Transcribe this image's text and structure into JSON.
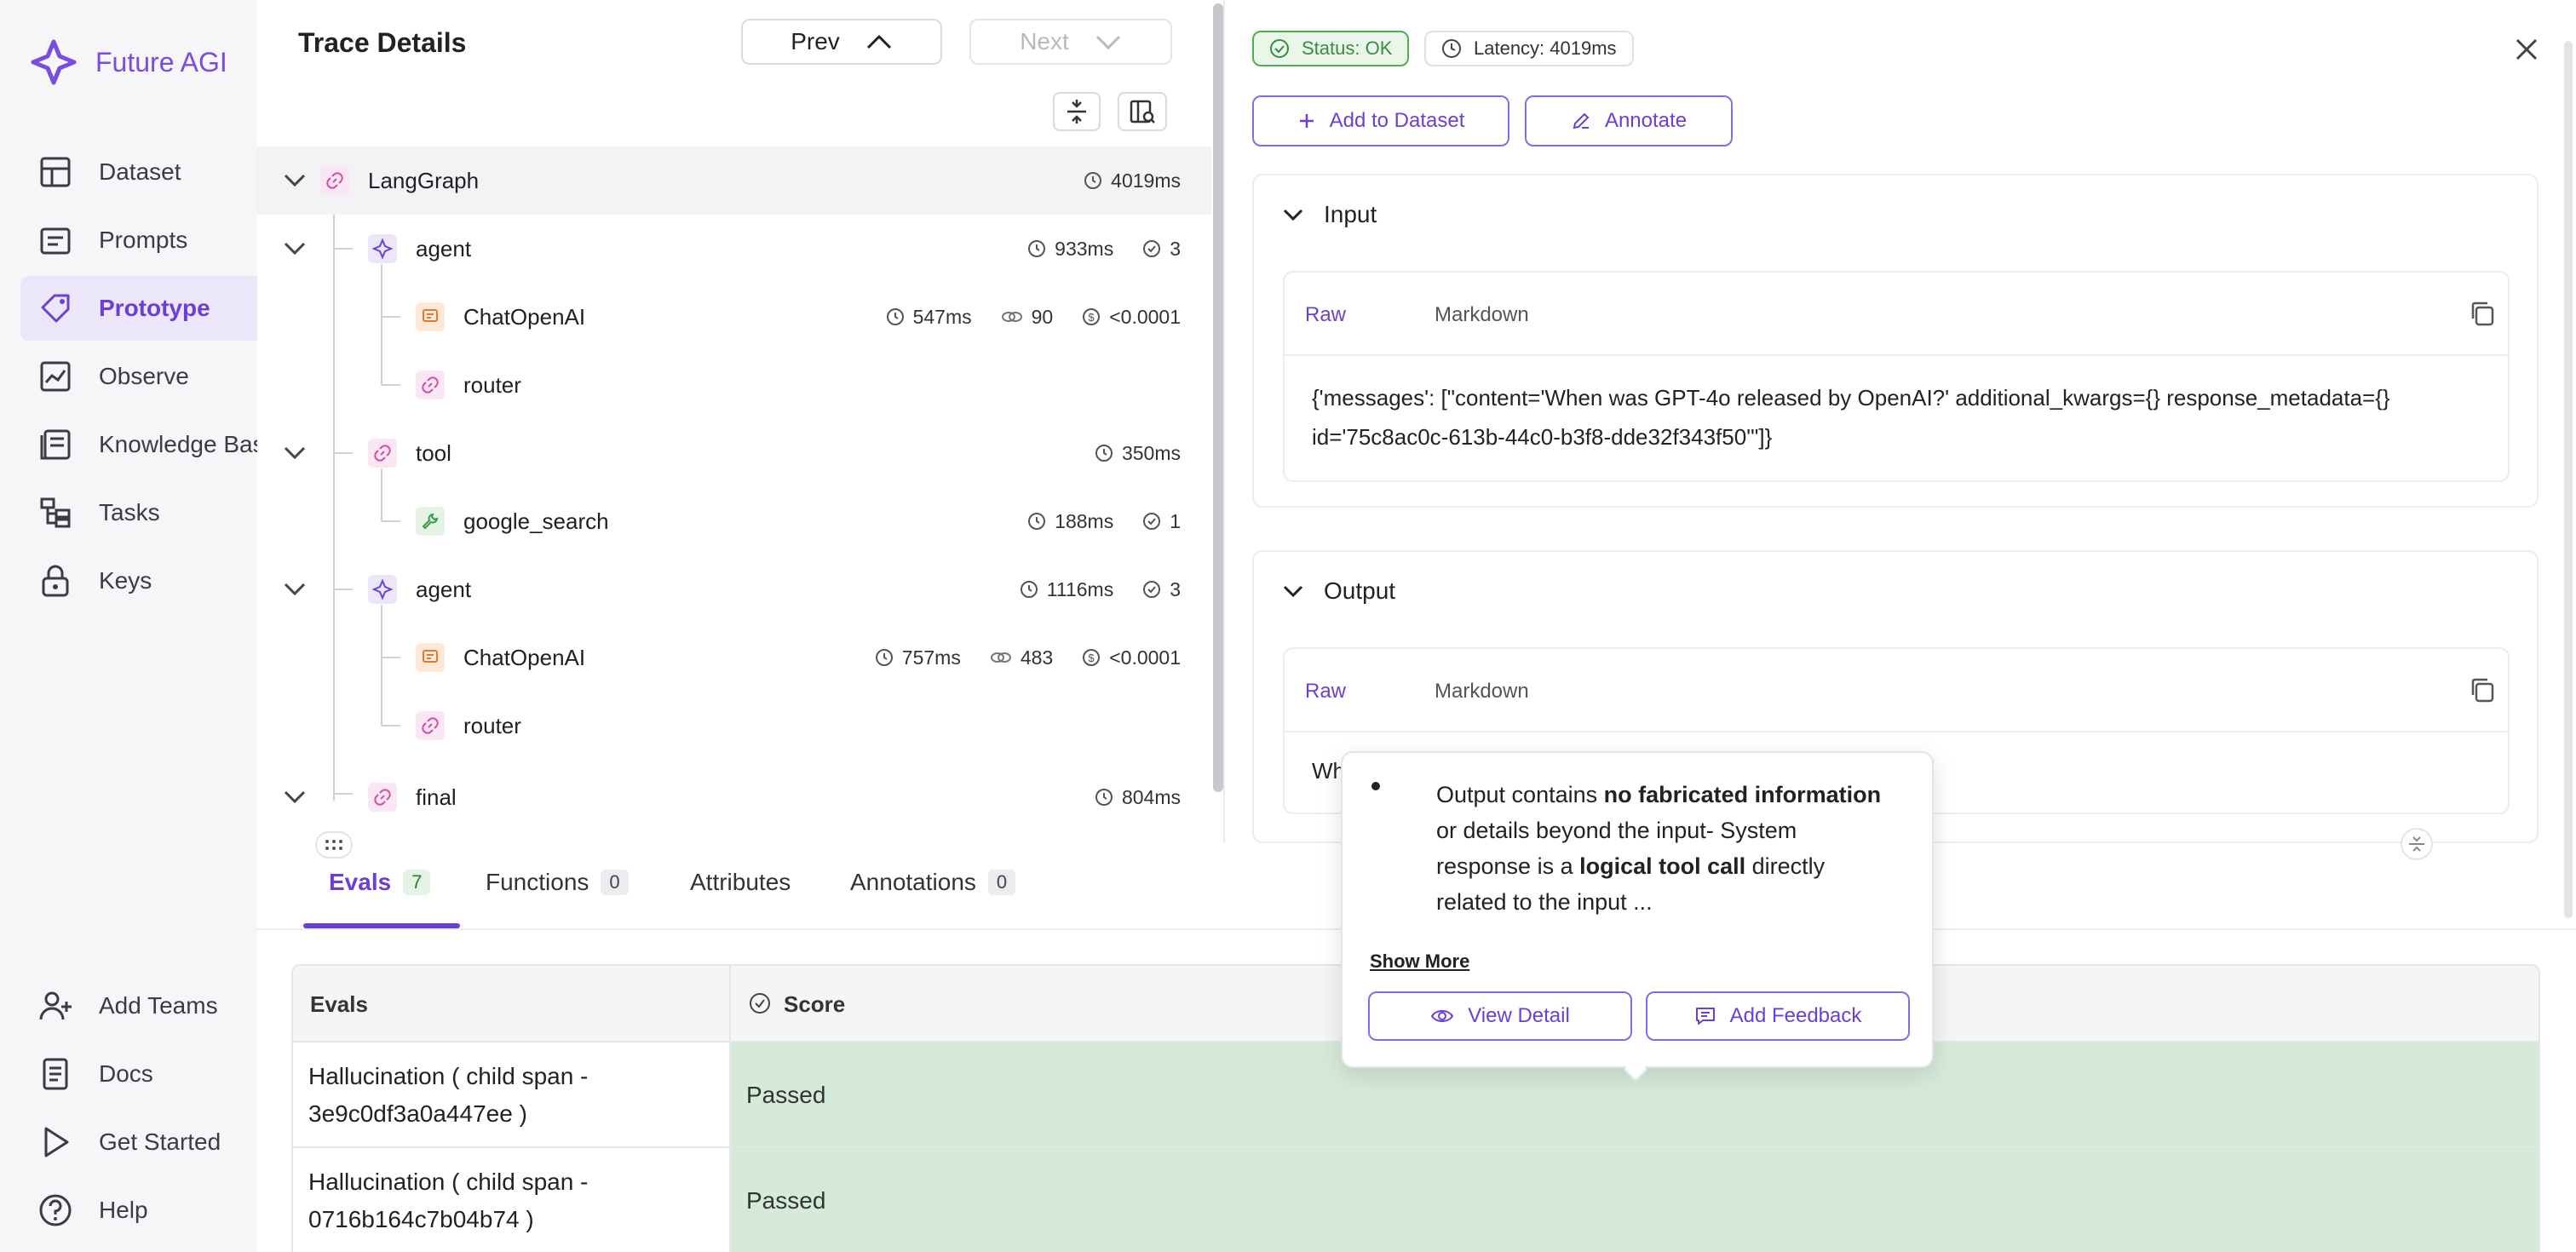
{
  "sidebar": {
    "brand": "Future AGI",
    "nav": [
      {
        "label": "Dataset",
        "icon": "table-icon"
      },
      {
        "label": "Prompts",
        "icon": "prompt-list-icon"
      },
      {
        "label": "Prototype",
        "icon": "tag-icon"
      },
      {
        "label": "Observe",
        "icon": "chart-icon"
      },
      {
        "label": "Knowledge Base",
        "icon": "book-icon"
      },
      {
        "label": "Tasks",
        "icon": "tasks-icon"
      },
      {
        "label": "Keys",
        "icon": "lock-icon"
      }
    ],
    "footer": [
      {
        "label": "Add Teams",
        "icon": "add-user-icon"
      },
      {
        "label": "Docs",
        "icon": "document-icon"
      },
      {
        "label": "Get Started",
        "icon": "play-icon"
      },
      {
        "label": "Help",
        "icon": "help-icon"
      }
    ],
    "active_color": "#6b3fd6"
  },
  "trace": {
    "title": "Trace Details",
    "prev_label": "Prev",
    "next_label": "Next",
    "rows": [
      {
        "name": "LangGraph",
        "latency": "4019ms"
      },
      {
        "name": "agent",
        "latency": "933ms",
        "count": "3"
      },
      {
        "name": "ChatOpenAI",
        "latency": "547ms",
        "tokens": "90",
        "cost": "<0.0001"
      },
      {
        "name": "router"
      },
      {
        "name": "tool",
        "latency": "350ms"
      },
      {
        "name": "google_search",
        "latency": "188ms",
        "count": "1"
      },
      {
        "name": "agent",
        "latency": "1116ms",
        "count": "3"
      },
      {
        "name": "ChatOpenAI",
        "latency": "757ms",
        "tokens": "483",
        "cost": "<0.0001"
      },
      {
        "name": "router"
      },
      {
        "name": "final",
        "latency": "804ms"
      }
    ]
  },
  "detail": {
    "status": "Status: OK",
    "latency": "Latency: 4019ms",
    "add_to_dataset": "Add to Dataset",
    "annotate": "Annotate",
    "input": {
      "title": "Input",
      "tab_raw": "Raw",
      "tab_markdown": "Markdown",
      "text": "{'messages': [\"content='When was GPT-4o released by OpenAI?' additional_kwargs={} response_metadata={} id='75c8ac0c-613b-44c0-b3f8-dde32f343f50'\"]}"
    },
    "output": {
      "title": "Output",
      "tab_raw": "Raw",
      "tab_markdown": "Markdown",
      "text": "Wh"
    }
  },
  "bottom_tabs": [
    {
      "label": "Evals",
      "count": "7"
    },
    {
      "label": "Functions",
      "count": "0"
    },
    {
      "label": "Attributes"
    },
    {
      "label": "Annotations",
      "count": "0"
    }
  ],
  "evals_table": {
    "headers": [
      "Evals",
      "Score"
    ],
    "rows": [
      {
        "eval": "Hallucination ( child span - 3e9c0df3a0a447ee )",
        "score": "Passed"
      },
      {
        "eval": "Hallucination ( child span - 0716b164c7b04b74 )",
        "score": "Passed"
      }
    ],
    "pass_color": "#d6ead9"
  },
  "tooltip": {
    "line1_pre": "Output contains ",
    "line1_bold": "no fabricated information",
    "line2": "or details beyond the input- System",
    "line3_pre": "response is a ",
    "line3_bold": "logical tool call",
    "line3_post": " directly",
    "line4": "related to the input ...",
    "show_more": "Show More",
    "view_detail": "View Detail",
    "add_feedback": "Add Feedback"
  }
}
